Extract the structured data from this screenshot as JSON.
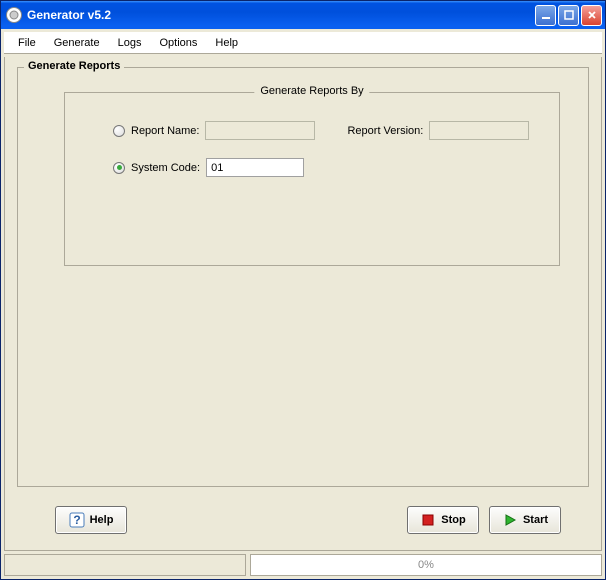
{
  "window": {
    "title": "Generator v5.2"
  },
  "menu": {
    "items": [
      "File",
      "Generate",
      "Logs",
      "Options",
      "Help"
    ]
  },
  "panel": {
    "title": "Generate Reports",
    "groupTitle": "Generate Reports By",
    "reportName": {
      "label": "Report Name:",
      "value": "",
      "selected": false
    },
    "reportVersion": {
      "label": "Report Version:",
      "value": ""
    },
    "systemCode": {
      "label": "System Code:",
      "value": "01",
      "selected": true
    }
  },
  "buttons": {
    "help": "Help",
    "stop": "Stop",
    "start": "Start"
  },
  "status": {
    "message": "",
    "progressText": "0%"
  }
}
